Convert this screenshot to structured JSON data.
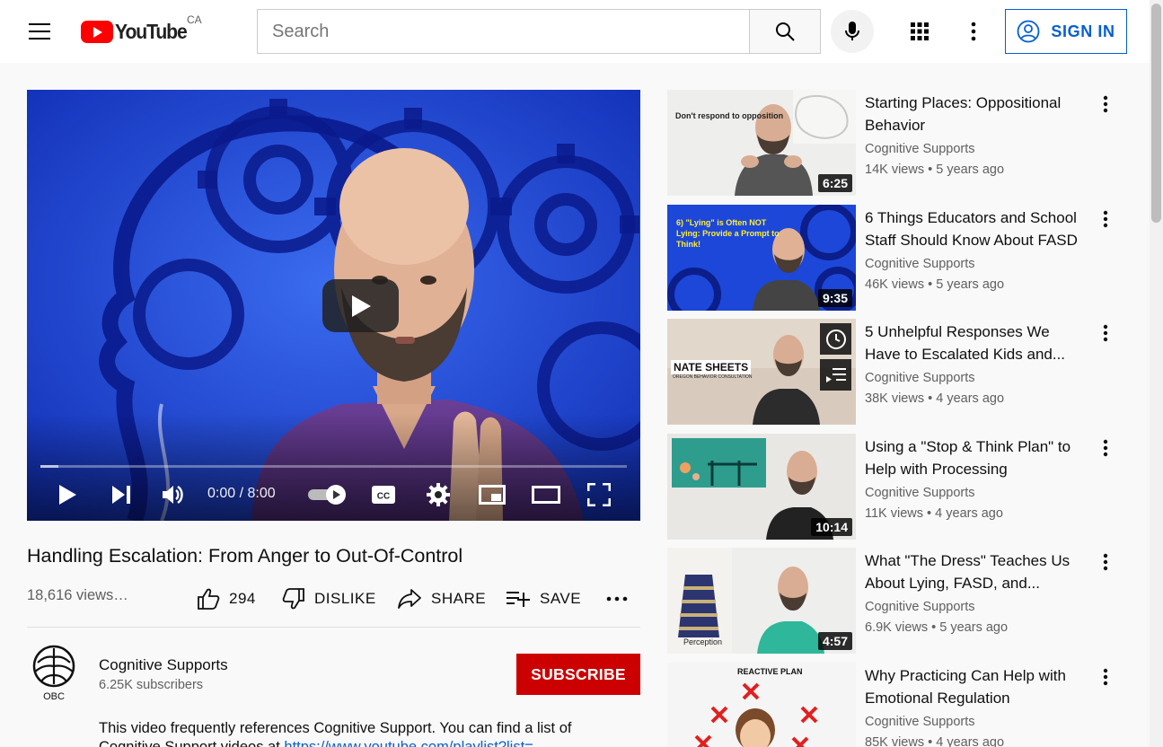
{
  "header": {
    "logo_text": "YouTube",
    "country": "CA",
    "search_placeholder": "Search",
    "sign_in_label": "SIGN IN",
    "icons": [
      "menu-icon",
      "search-icon",
      "microphone-icon",
      "apps-icon",
      "more-vert-icon",
      "account-circle-icon"
    ]
  },
  "player": {
    "time": "0:00 / 8:00",
    "progress_fraction": 0.03
  },
  "video": {
    "title": "Handling Escalation: From Anger to Out-Of-Control",
    "views": "18,616 views…",
    "likes": "294",
    "dislike_label": "DISLIKE",
    "share_label": "SHARE",
    "save_label": "SAVE"
  },
  "channel": {
    "name": "Cognitive Supports",
    "subscribers": "6.25K subscribers",
    "avatar_text": "OBC",
    "subscribe_label": "SUBSCRIBE"
  },
  "description": {
    "text": "This video frequently references Cognitive Support. You can find a list of",
    "line2_prefix": "Cognitive Support videos at",
    "link": "https://www.youtube.com/playlist?list=..."
  },
  "related": [
    {
      "title": "Starting Places: Oppositional Behavior",
      "channel": "Cognitive Supports",
      "views": "14K views",
      "age": "5 years ago",
      "duration": "6:25",
      "thumb_text": "Don't respond to opposition"
    },
    {
      "title": "6 Things Educators and School Staff Should Know About FASD",
      "channel": "Cognitive Supports",
      "views": "46K views",
      "age": "5 years ago",
      "duration": "9:35",
      "thumb_text": "6) \"Lying\" is Often NOT Lying: Provide a Prompt to Think!"
    },
    {
      "title": "5 Unhelpful Responses We Have to Escalated Kids and...",
      "channel": "Cognitive Supports",
      "views": "38K views",
      "age": "4 years ago",
      "duration": "",
      "thumb_text": "NATE SHEETS",
      "thumb_subtext": "OREGON BEHAVIOR CONSULTATION"
    },
    {
      "title": "Using a \"Stop & Think Plan\" to Help with Processing",
      "channel": "Cognitive Supports",
      "views": "11K views",
      "age": "4 years ago",
      "duration": "10:14",
      "thumb_text": ""
    },
    {
      "title": "What \"The Dress\" Teaches Us About Lying, FASD, and...",
      "channel": "Cognitive Supports",
      "views": "6.9K views",
      "age": "5 years ago",
      "duration": "4:57",
      "thumb_text": "Perception"
    },
    {
      "title": "Why Practicing Can Help with Emotional Regulation",
      "channel": "Cognitive Supports",
      "views": "85K views",
      "age": "4 years ago",
      "duration": "",
      "thumb_text": "REACTIVE PLAN"
    }
  ]
}
